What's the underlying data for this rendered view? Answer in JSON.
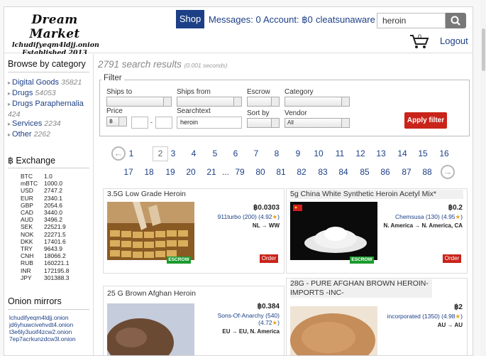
{
  "header": {
    "logo_title": "Dream Market",
    "logo_url": "lchudifyeqm4ldjj.onion",
    "logo_est": "Established 2013",
    "shop": "Shop",
    "messages": "Messages: 0",
    "account": "Account: ฿0",
    "username": "cleatsunaware",
    "search_value": "heroin",
    "cart_count": "0",
    "logout": "Logout"
  },
  "sidebar": {
    "browse_title": "Browse by category",
    "categories": [
      {
        "name": "Digital Goods",
        "count": "35821"
      },
      {
        "name": "Drugs",
        "count": "54053"
      },
      {
        "name": "Drugs Paraphernalia",
        "count": "424"
      },
      {
        "name": "Services",
        "count": "2234"
      },
      {
        "name": "Other",
        "count": "2262"
      }
    ],
    "exchange_title": "฿ Exchange",
    "rates": [
      {
        "c": "BTC",
        "v": "1.0"
      },
      {
        "c": "mBTC",
        "v": "1000.0"
      },
      {
        "c": "USD",
        "v": "2747.2"
      },
      {
        "c": "EUR",
        "v": "2340.1"
      },
      {
        "c": "GBP",
        "v": "2054.6"
      },
      {
        "c": "CAD",
        "v": "3440.0"
      },
      {
        "c": "AUD",
        "v": "3496.2"
      },
      {
        "c": "SEK",
        "v": "22521.9"
      },
      {
        "c": "NOK",
        "v": "22271.5"
      },
      {
        "c": "DKK",
        "v": "17401.6"
      },
      {
        "c": "TRY",
        "v": "9643.9"
      },
      {
        "c": "CNH",
        "v": "18066.2"
      },
      {
        "c": "RUB",
        "v": "160221.1"
      },
      {
        "c": "INR",
        "v": "172195.8"
      },
      {
        "c": "JPY",
        "v": "301388.3"
      }
    ],
    "mirrors_title": "Onion mirrors",
    "mirrors": [
      "lchudifyeqm4ldjj.onion",
      "jd6yhuwcivehvdt4.onion",
      "t3e6ly3uoif4zcw2.onion",
      "7ep7acrkunzdcw3l.onion"
    ]
  },
  "main": {
    "results": "2791 search results",
    "results_time": "(0.001 seconds)",
    "filter": {
      "legend": "Filter",
      "ships_to": "Ships to",
      "ships_from": "Ships from",
      "escrow": "Escrow",
      "category": "Category",
      "price": "Price",
      "price_currency": "฿",
      "dash": "-",
      "searchtext": "Searchtext",
      "searchtext_value": "heroin",
      "sort_by": "Sort by",
      "vendor": "Vendor",
      "vendor_value": "All",
      "apply": "Apply filter"
    },
    "pages_row1": [
      "1",
      "3",
      "4",
      "5",
      "6",
      "7",
      "8",
      "9",
      "10",
      "11",
      "12",
      "13",
      "14",
      "15",
      "16"
    ],
    "current_page": "2",
    "pages_row2": [
      "17",
      "18",
      "19",
      "20",
      "21",
      "...",
      "79",
      "80",
      "81",
      "82",
      "83",
      "84",
      "85",
      "86",
      "87",
      "88"
    ],
    "prev_icon": "←",
    "next_icon": "→",
    "listings": [
      {
        "title": "3.5G Low Grade Heroin",
        "price": "฿0.0303",
        "vendor": "911turbo (200) (4.92★)",
        "ship": "NL → WW",
        "escrow": "ESCROW",
        "order": "Order"
      },
      {
        "title": "5g China White Synthetic Heroin Acetyl Mix*",
        "price": "฿0.2",
        "vendor": "Chemsusa (130) (4.95★)",
        "ship": "N. America → N. America, CA",
        "escrow": "ESCROW",
        "order": "Order"
      },
      {
        "title": "25 G Brown Afghan Heroin",
        "price": "฿0.384",
        "vendor": "Sons-Of-Anarchy (540)",
        "vendor2": "(4.72★)",
        "ship": "EU → EU, N. America"
      },
      {
        "title": "28G - PURE AFGHAN BROWN HEROIN-IMPORTS -INC-",
        "price": "฿2",
        "vendor": "incorporated (1350) (4.98★)",
        "ship": "AU → AU"
      }
    ]
  },
  "colors": {
    "accent": "#1c3f86",
    "order_red": "#c9241a",
    "escrow_green": "#1b9b2e"
  },
  "icons": {
    "search": "magnifier-icon",
    "cart": "cart-icon"
  }
}
